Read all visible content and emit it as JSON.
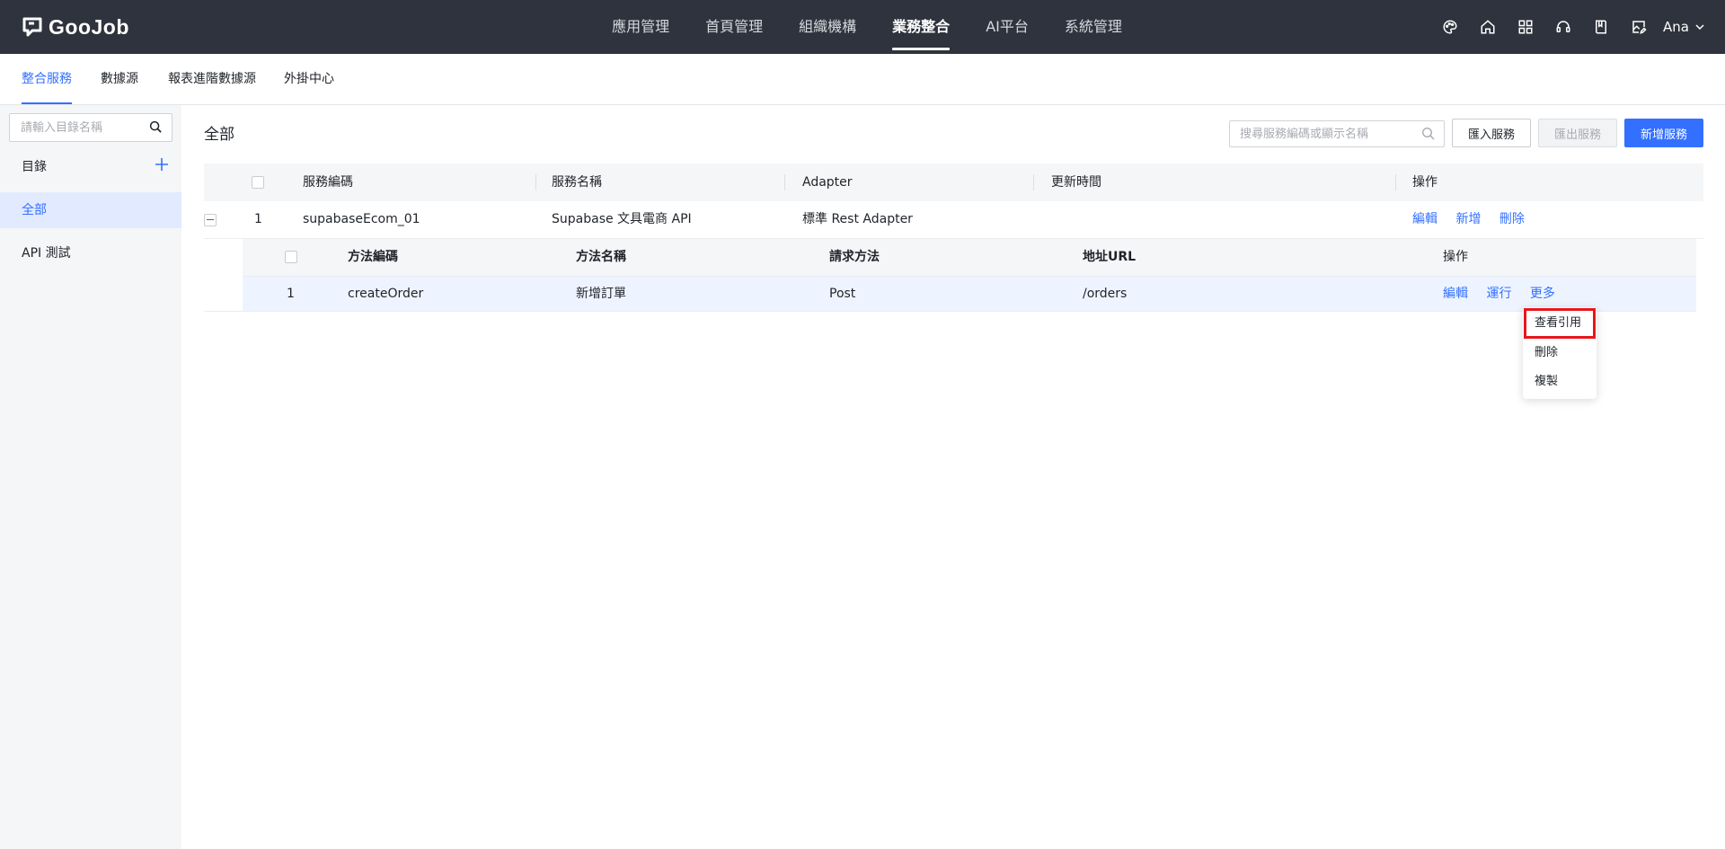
{
  "app": {
    "logo_text": "GooJob"
  },
  "topnav": {
    "items": [
      {
        "label": "應用管理"
      },
      {
        "label": "首頁管理"
      },
      {
        "label": "組織機構"
      },
      {
        "label": "業務整合"
      },
      {
        "label": "AI平台"
      },
      {
        "label": "系統管理"
      }
    ],
    "active_index": 3
  },
  "top_icons": [
    "palette-icon",
    "home-icon",
    "apps-grid-icon",
    "headset-support-icon",
    "book-icon",
    "image-edit-icon"
  ],
  "user": {
    "name": "Ana"
  },
  "subtabs": {
    "items": [
      {
        "label": "整合服務"
      },
      {
        "label": "數據源"
      },
      {
        "label": "報表進階數據源"
      },
      {
        "label": "外掛中心"
      }
    ],
    "active_index": 0
  },
  "sidebar": {
    "search_placeholder": "請輸入目錄名稱",
    "directory_label": "目錄",
    "items": [
      {
        "label": "全部",
        "active": true
      },
      {
        "label": "API 測試",
        "active": false
      }
    ]
  },
  "main": {
    "title": "全部",
    "search_placeholder": "搜尋服務編碼或顯示名稱",
    "buttons": {
      "import": "匯入服務",
      "export": "匯出服務",
      "new": "新增服務"
    }
  },
  "table": {
    "headers": {
      "code": "服務編碼",
      "name": "服務名稱",
      "adapter": "Adapter",
      "updated": "更新時間",
      "actions": "操作"
    },
    "rows": [
      {
        "index": "1",
        "code": "supabaseEcom_01",
        "name": "Supabase 文具電商 API",
        "adapter": "標準 Rest Adapter",
        "updated": "",
        "actions": {
          "edit": "編輯",
          "add": "新增",
          "delete": "刪除"
        }
      }
    ]
  },
  "subtable": {
    "headers": {
      "code": "方法編碼",
      "name": "方法名稱",
      "method": "請求方法",
      "url": "地址URL",
      "actions": "操作"
    },
    "rows": [
      {
        "index": "1",
        "code": "createOrder",
        "name": "新增訂單",
        "method": "Post",
        "url": "/orders",
        "actions": {
          "edit": "編輯",
          "run": "運行",
          "more": "更多"
        }
      }
    ]
  },
  "more_menu": {
    "items": [
      {
        "label": "查看引用",
        "highlighted": true
      },
      {
        "label": "刪除",
        "highlighted": false
      },
      {
        "label": "複製",
        "highlighted": false
      }
    ]
  },
  "colors": {
    "topbar_bg": "#2f333d",
    "primary": "#3370ff",
    "highlight_border": "#e8161c",
    "sidebar_bg": "#f5f6f7"
  }
}
